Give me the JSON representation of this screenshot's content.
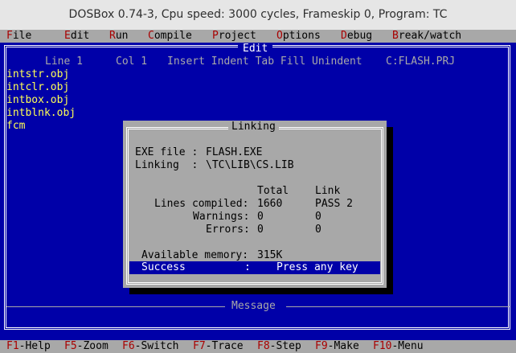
{
  "window": {
    "title": "DOSBox 0.74-3, Cpu speed:   3000 cycles, Frameskip  0, Program:     TC"
  },
  "menu": [
    {
      "hotkey": "F",
      "rest": "ile"
    },
    {
      "hotkey": "E",
      "rest": "dit"
    },
    {
      "hotkey": "R",
      "rest": "un"
    },
    {
      "hotkey": "C",
      "rest": "ompile"
    },
    {
      "hotkey": "P",
      "rest": "roject"
    },
    {
      "hotkey": "O",
      "rest": "ptions"
    },
    {
      "hotkey": "D",
      "rest": "ebug"
    },
    {
      "hotkey": "B",
      "rest": "reak/watch"
    }
  ],
  "editor": {
    "title": "Edit",
    "status": {
      "line": "Line 1",
      "col": "Col 1",
      "modes": "Insert Indent Tab Fill Unindent",
      "file": "C:FLASH.PRJ"
    },
    "lines": [
      "intstr.obj",
      "intclr.obj",
      "intbox.obj",
      "intblnk.obj",
      "fcm"
    ]
  },
  "dialog": {
    "title": "Linking",
    "exe_label": "EXE file : ",
    "exe_value": "FLASH.EXE",
    "linking_label": "Linking  : ",
    "linking_value": "\\TC\\LIB\\CS.LIB",
    "col_total": "Total",
    "col_link": "Link",
    "rows": [
      {
        "label": "Lines compiled:",
        "total": "1660",
        "link": "PASS 2"
      },
      {
        "label": "Warnings:",
        "total": "0",
        "link": "0"
      },
      {
        "label": "Errors:",
        "total": "0",
        "link": "0"
      }
    ],
    "memory_label": "Available memory:",
    "memory_value": "315K",
    "success_label": "Success",
    "success_sep": ":",
    "success_msg": "Press any key"
  },
  "message_title": "Message",
  "function_keys": [
    {
      "key": "F1",
      "label": "-Help"
    },
    {
      "key": "F5",
      "label": "-Zoom"
    },
    {
      "key": "F6",
      "label": "-Switch"
    },
    {
      "key": "F7",
      "label": "-Trace"
    },
    {
      "key": "F8",
      "label": "-Step"
    },
    {
      "key": "F9",
      "label": "-Make"
    },
    {
      "key": "F10",
      "label": "-Menu"
    }
  ]
}
